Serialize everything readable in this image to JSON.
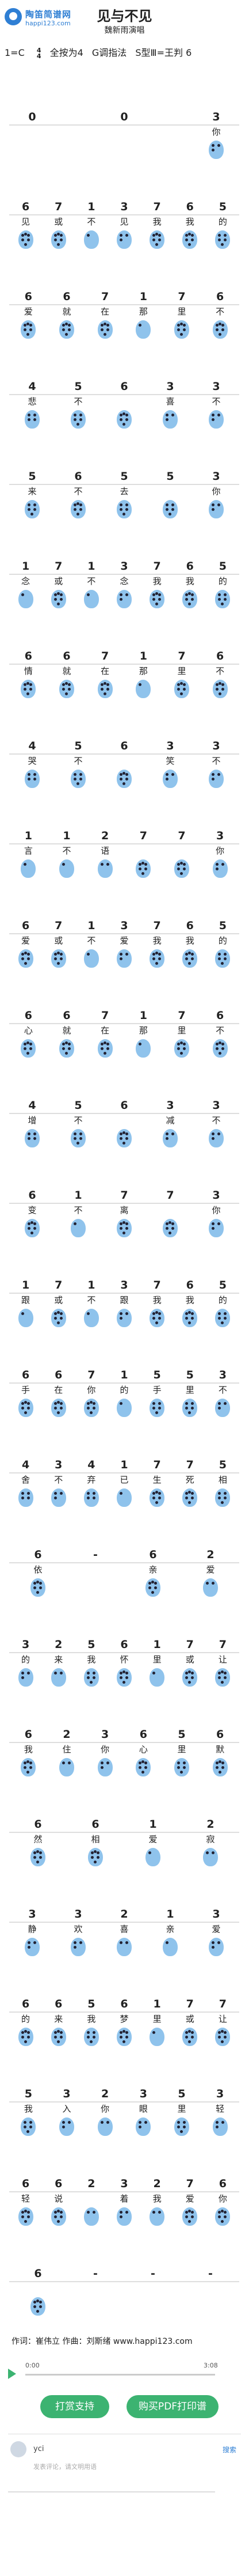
{
  "header": {
    "logo_name": "陶笛简谱网",
    "logo_url": "happi123.com",
    "title": "见与不见",
    "singer": "魏新雨演唱",
    "key": "1=C",
    "time_top": "4",
    "time_bottom": "4",
    "holes": "全按为4",
    "tuning": "G调指法",
    "extra": "S型Ⅲ=王判 6"
  },
  "rows": [
    {
      "cells": [
        {
          "n": "0",
          "l": ""
        },
        {
          "n": "",
          "l": ""
        },
        {
          "n": "0",
          "l": ""
        },
        {
          "n": "",
          "l": ""
        },
        {
          "n": "3",
          "l": "你"
        }
      ]
    },
    {
      "cells": [
        {
          "n": "6",
          "l": "见"
        },
        {
          "n": "7",
          "l": "或"
        },
        {
          "n": "1",
          "l": "不"
        },
        {
          "n": "3",
          "l": "见"
        },
        {
          "n": "7",
          "l": "我"
        },
        {
          "n": "6",
          "l": "我"
        },
        {
          "n": "5",
          "l": "的"
        }
      ]
    },
    {
      "cells": [
        {
          "n": "6",
          "l": "爱"
        },
        {
          "n": "6",
          "l": "就"
        },
        {
          "n": "7",
          "l": "在"
        },
        {
          "n": "1",
          "l": "那"
        },
        {
          "n": "7",
          "l": "里"
        },
        {
          "n": "6",
          "l": "不"
        }
      ]
    },
    {
      "cells": [
        {
          "n": "4",
          "l": "悲"
        },
        {
          "n": "5",
          "l": "不"
        },
        {
          "n": "6",
          "l": ""
        },
        {
          "n": "3",
          "l": "喜"
        },
        {
          "n": "3",
          "l": "不"
        }
      ]
    },
    {
      "cells": [
        {
          "n": "5",
          "l": "来"
        },
        {
          "n": "6",
          "l": "不"
        },
        {
          "n": "5",
          "l": "去"
        },
        {
          "n": "5",
          "l": ""
        },
        {
          "n": "3",
          "l": "你"
        }
      ]
    },
    {
      "cells": [
        {
          "n": "1",
          "l": "念"
        },
        {
          "n": "7",
          "l": "或"
        },
        {
          "n": "1",
          "l": "不"
        },
        {
          "n": "3",
          "l": "念"
        },
        {
          "n": "7",
          "l": "我"
        },
        {
          "n": "6",
          "l": "我"
        },
        {
          "n": "5",
          "l": "的"
        }
      ]
    },
    {
      "cells": [
        {
          "n": "6",
          "l": "情"
        },
        {
          "n": "6",
          "l": "就"
        },
        {
          "n": "7",
          "l": "在"
        },
        {
          "n": "1",
          "l": "那"
        },
        {
          "n": "7",
          "l": "里"
        },
        {
          "n": "6",
          "l": "不"
        }
      ]
    },
    {
      "cells": [
        {
          "n": "4",
          "l": "哭"
        },
        {
          "n": "5",
          "l": "不"
        },
        {
          "n": "6",
          "l": ""
        },
        {
          "n": "3",
          "l": "笑"
        },
        {
          "n": "3",
          "l": "不"
        }
      ]
    },
    {
      "cells": [
        {
          "n": "1",
          "l": "言"
        },
        {
          "n": "1",
          "l": "不"
        },
        {
          "n": "2",
          "l": "语"
        },
        {
          "n": "7",
          "l": ""
        },
        {
          "n": "7",
          "l": ""
        },
        {
          "n": "3",
          "l": "你"
        }
      ]
    },
    {
      "cells": [
        {
          "n": "6",
          "l": "爱"
        },
        {
          "n": "7",
          "l": "或"
        },
        {
          "n": "1",
          "l": "不"
        },
        {
          "n": "3",
          "l": "爱"
        },
        {
          "n": "7",
          "l": "我"
        },
        {
          "n": "6",
          "l": "我"
        },
        {
          "n": "5",
          "l": "的"
        }
      ]
    },
    {
      "cells": [
        {
          "n": "6",
          "l": "心"
        },
        {
          "n": "6",
          "l": "就"
        },
        {
          "n": "7",
          "l": "在"
        },
        {
          "n": "1",
          "l": "那"
        },
        {
          "n": "7",
          "l": "里"
        },
        {
          "n": "6",
          "l": "不"
        }
      ]
    },
    {
      "cells": [
        {
          "n": "4",
          "l": "增"
        },
        {
          "n": "5",
          "l": "不"
        },
        {
          "n": "6",
          "l": ""
        },
        {
          "n": "3",
          "l": "减"
        },
        {
          "n": "3",
          "l": "不"
        }
      ]
    },
    {
      "cells": [
        {
          "n": "6",
          "l": "变"
        },
        {
          "n": "1",
          "l": "不"
        },
        {
          "n": "7",
          "l": "离"
        },
        {
          "n": "7",
          "l": ""
        },
        {
          "n": "3",
          "l": "你"
        }
      ]
    },
    {
      "cells": [
        {
          "n": "1",
          "l": "跟"
        },
        {
          "n": "7",
          "l": "或"
        },
        {
          "n": "1",
          "l": "不"
        },
        {
          "n": "3",
          "l": "跟"
        },
        {
          "n": "7",
          "l": "我"
        },
        {
          "n": "6",
          "l": "我"
        },
        {
          "n": "5",
          "l": "的"
        }
      ]
    },
    {
      "cells": [
        {
          "n": "6",
          "l": "手"
        },
        {
          "n": "6",
          "l": "在"
        },
        {
          "n": "7",
          "l": "你"
        },
        {
          "n": "1",
          "l": "的"
        },
        {
          "n": "5",
          "l": "手"
        },
        {
          "n": "5",
          "l": "里"
        },
        {
          "n": "3",
          "l": "不"
        }
      ]
    },
    {
      "cells": [
        {
          "n": "4",
          "l": "舍"
        },
        {
          "n": "3",
          "l": "不"
        },
        {
          "n": "4",
          "l": "弃"
        },
        {
          "n": "1",
          "l": "已"
        },
        {
          "n": "7",
          "l": "生"
        },
        {
          "n": "7",
          "l": "死"
        },
        {
          "n": "5",
          "l": "相"
        }
      ]
    },
    {
      "cells": [
        {
          "n": "6",
          "l": "依"
        },
        {
          "n": "-",
          "l": ""
        },
        {
          "n": "6",
          "l": "亲"
        },
        {
          "n": "2",
          "l": "爱"
        }
      ]
    },
    {
      "cells": [
        {
          "n": "3",
          "l": "的"
        },
        {
          "n": "2",
          "l": "来"
        },
        {
          "n": "5",
          "l": "我"
        },
        {
          "n": "6",
          "l": "怀"
        },
        {
          "n": "1",
          "l": "里"
        },
        {
          "n": "7",
          "l": "或"
        },
        {
          "n": "7",
          "l": "让"
        }
      ]
    },
    {
      "cells": [
        {
          "n": "6",
          "l": "我"
        },
        {
          "n": "2",
          "l": "住"
        },
        {
          "n": "3",
          "l": "你"
        },
        {
          "n": "6",
          "l": "心"
        },
        {
          "n": "5",
          "l": "里"
        },
        {
          "n": "6",
          "l": "默"
        }
      ]
    },
    {
      "cells": [
        {
          "n": "6",
          "l": "然"
        },
        {
          "n": "6",
          "l": "相"
        },
        {
          "n": "1",
          "l": "爱"
        },
        {
          "n": "2",
          "l": "寂"
        }
      ]
    },
    {
      "cells": [
        {
          "n": "3",
          "l": "静"
        },
        {
          "n": "3",
          "l": "欢"
        },
        {
          "n": "2",
          "l": "喜"
        },
        {
          "n": "1",
          "l": "亲"
        },
        {
          "n": "3",
          "l": "爱"
        }
      ]
    },
    {
      "cells": [
        {
          "n": "6",
          "l": "的"
        },
        {
          "n": "6",
          "l": "来"
        },
        {
          "n": "5",
          "l": "我"
        },
        {
          "n": "6",
          "l": "梦"
        },
        {
          "n": "1",
          "l": "里"
        },
        {
          "n": "7",
          "l": "或"
        },
        {
          "n": "7",
          "l": "让"
        }
      ]
    },
    {
      "cells": [
        {
          "n": "5",
          "l": "我"
        },
        {
          "n": "3",
          "l": "入"
        },
        {
          "n": "2",
          "l": "你"
        },
        {
          "n": "3",
          "l": "眼"
        },
        {
          "n": "5",
          "l": "里"
        },
        {
          "n": "3",
          "l": "轻"
        }
      ]
    },
    {
      "cells": [
        {
          "n": "6",
          "l": "轻"
        },
        {
          "n": "6",
          "l": "说"
        },
        {
          "n": "2",
          "l": ""
        },
        {
          "n": "3",
          "l": "着"
        },
        {
          "n": "2",
          "l": "我"
        },
        {
          "n": "7",
          "l": "爱"
        },
        {
          "n": "6",
          "l": "你"
        }
      ]
    },
    {
      "cells": [
        {
          "n": "6",
          "l": ""
        },
        {
          "n": "-",
          "l": ""
        },
        {
          "n": "-",
          "l": ""
        },
        {
          "n": "-",
          "l": ""
        }
      ]
    }
  ],
  "footer": {
    "credit": "作词：崔伟立  作曲：刘斯绪  www.happi123.com",
    "t_start": "0:00",
    "t_end": "3:08",
    "btn_support": "打赏支持",
    "btn_pdf": "购买PDF打印谱",
    "user": "yci",
    "reply": "搜索",
    "placeholder": "发表评论，请文明用语"
  }
}
